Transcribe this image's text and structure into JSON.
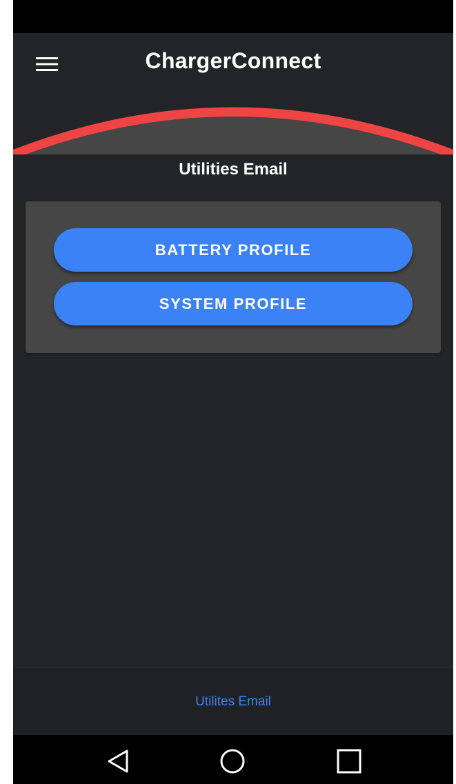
{
  "app_bar": {
    "title": "ChargerConnect",
    "menu_icon": "hamburger-menu-icon"
  },
  "page": {
    "heading": "Utilities Email"
  },
  "card": {
    "buttons": [
      {
        "label": "BATTERY PROFILE"
      },
      {
        "label": "SYSTEM PROFILE"
      }
    ]
  },
  "bottom_nav": {
    "item_label": "Utilites Email"
  },
  "system_nav": {
    "back_icon": "back-triangle-icon",
    "home_icon": "home-circle-icon",
    "recent_icon": "recent-apps-square-icon"
  },
  "colors": {
    "background": "#232428",
    "accent_blue": "#3b82f6",
    "arc_red": "#ef4444",
    "card_gray": "#464646"
  }
}
